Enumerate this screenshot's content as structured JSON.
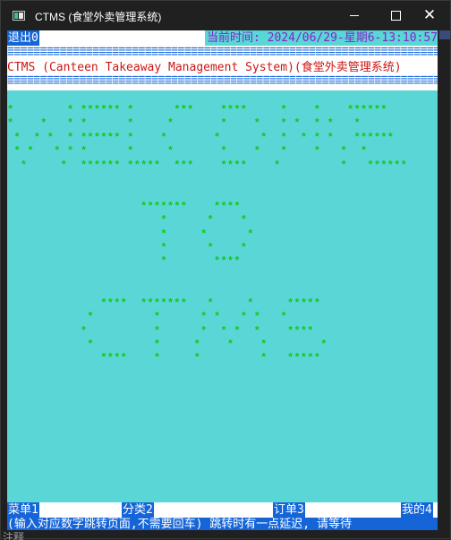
{
  "window": {
    "title": "CTMS (食堂外卖管理系统)",
    "minimize": "—",
    "maximize": "□",
    "close": "✕"
  },
  "console": {
    "exit": "退出0",
    "clock": "当前时间: 2024/06/29-星期6-13:10:57",
    "separator": "==========================================================================================",
    "system_title": "CTMS (Canteen Takeaway Management System)(食堂外卖管理系统)",
    "banner": "*        * ****** *      ***    ****     *    *    ******\n*    *   * *      *     *       *    *   * *  * *   *\n *  * *  * ****** *    *       *      *  *  * * *   ******\n * *   * * *      *     *       *    *   *    *   *  *\n  *     *  ****** *****  ***    ****    *         *   ******\n\n\n                    *******    ****\n                       *      *    *\n                       *     *      *\n                       *      *    *\n                       *       ****\n\n\n              ****  *******   *     *     *****\n            *         *      * *   * *   *\n           *          *      *  * *  *    ****\n            *         *     *    *    *        *\n              ****    *     *         *   *****",
    "menu": {
      "item1": "菜单1",
      "item2": "分类2",
      "item3": "订单3",
      "item4": "我的4"
    },
    "hint": "(输入对应数字跳转页面,不需要回车) 跳转时有一点延迟, 请等待"
  },
  "behind_text": "注释"
}
